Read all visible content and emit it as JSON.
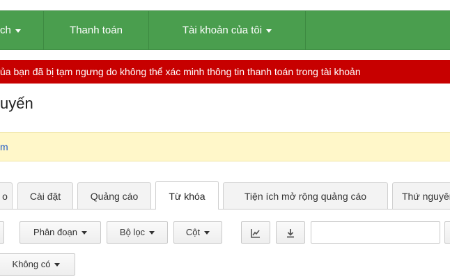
{
  "nav": {
    "items": [
      {
        "label": "ch",
        "has_caret": true
      },
      {
        "label": "Thanh toán",
        "has_caret": false
      },
      {
        "label": "Tài khoản của tôi",
        "has_caret": true
      }
    ]
  },
  "alert": {
    "text": "ủa bạn đã bị tạm ngưng do không thể xác minh thông tin thanh toán trong tài khoản"
  },
  "page": {
    "title": "uyến"
  },
  "notice": {
    "link_text": "m"
  },
  "tabs": [
    {
      "label": "o"
    },
    {
      "label": "Cài đặt"
    },
    {
      "label": "Quảng cáo"
    },
    {
      "label": "Từ khóa",
      "active": true
    },
    {
      "label": "Tiện ích mở rộng quảng cáo"
    },
    {
      "label": "Thứ nguyên"
    }
  ],
  "toolbar": {
    "segment_label": "Phân đoạn",
    "filter_label": "Bộ lọc",
    "columns_label": "Cột",
    "chart_icon": "line-chart-icon",
    "download_icon": "download-icon"
  },
  "secondary": {
    "select_label": "Không có"
  },
  "colors": {
    "nav_green": "#4a9e4e",
    "alert_red": "#c70000",
    "notice_yellow": "#fff7c9",
    "link_blue": "#1b57c7"
  }
}
